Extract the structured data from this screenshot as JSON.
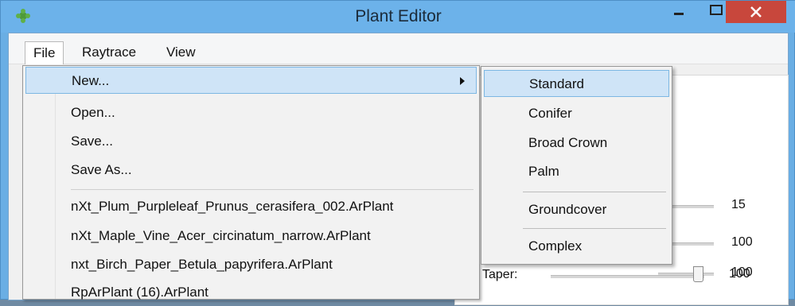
{
  "window": {
    "title": "Plant Editor",
    "minimize_label": "–",
    "maximize_label": "☐",
    "close_label": "✕",
    "icon": "plant-leaf-icon"
  },
  "menubar": {
    "file": "File",
    "raytrace": "Raytrace",
    "view": "View"
  },
  "file_menu": {
    "items": [
      {
        "label": "New..."
      },
      {
        "label": "Open..."
      },
      {
        "label": "Save..."
      },
      {
        "label": "Save As..."
      },
      {
        "label": "nXt_Plum_Purpleleaf_Prunus_cerasifera_002.ArPlant"
      },
      {
        "label": "nXt_Maple_Vine_Acer_circinatum_narrow.ArPlant"
      },
      {
        "label": "nxt_Birch_Paper_Betula_papyrifera.ArPlant"
      },
      {
        "label": "RpArPlant (16).ArPlant"
      }
    ]
  },
  "new_submenu": {
    "items": [
      {
        "label": "Standard"
      },
      {
        "label": "Conifer"
      },
      {
        "label": "Broad Crown"
      },
      {
        "label": "Palm"
      },
      {
        "label": "Groundcover"
      },
      {
        "label": "Complex"
      }
    ]
  },
  "panel": {
    "values": [
      "15",
      "100",
      "100",
      "100"
    ],
    "taper_label": "Taper:"
  },
  "colors": {
    "titlebar": "#6cb2ea",
    "close_button": "#c8473c",
    "highlight": "#cfe4f7"
  }
}
